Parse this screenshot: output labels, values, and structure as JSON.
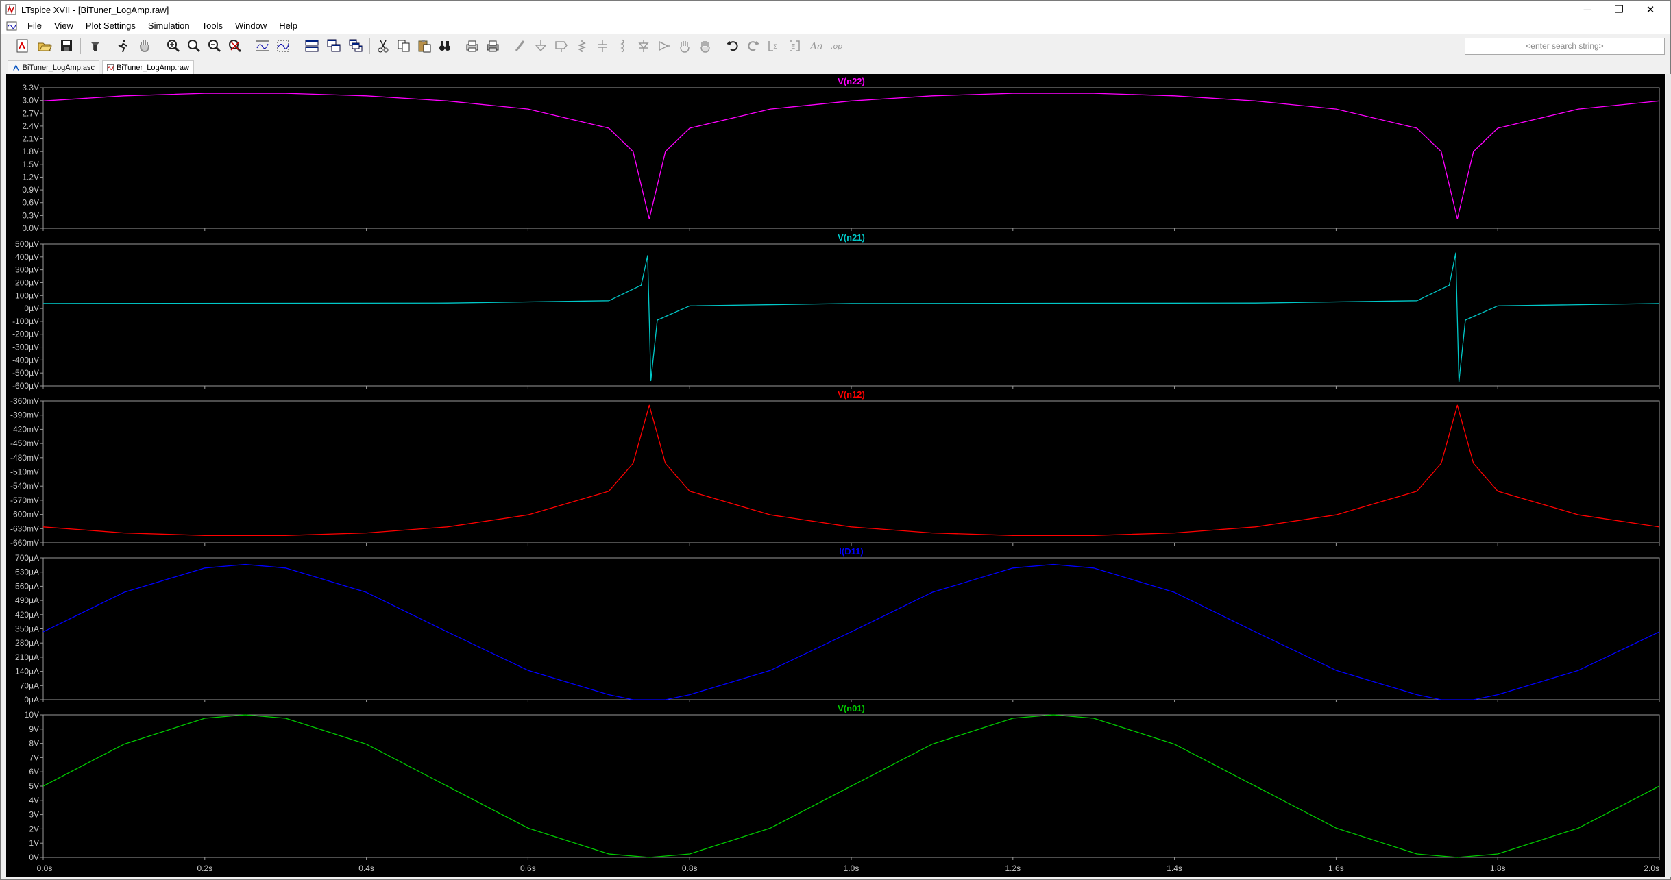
{
  "window": {
    "title": "LTspice XVII - [BiTuner_LogAmp.raw]",
    "minimize": "─",
    "restore": "❐",
    "close": "✕"
  },
  "menu": {
    "items": [
      {
        "label": "File",
        "icon": "file-menu"
      },
      {
        "label": "View",
        "icon": "view-menu"
      },
      {
        "label": "Plot Settings",
        "icon": "plot-settings-menu"
      },
      {
        "label": "Simulation",
        "icon": "simulation-menu"
      },
      {
        "label": "Tools",
        "icon": "tools-menu"
      },
      {
        "label": "Window",
        "icon": "window-menu"
      },
      {
        "label": "Help",
        "icon": "help-menu"
      }
    ],
    "mdi_minimize": "_",
    "mdi_restore": "▫",
    "mdi_close": "×"
  },
  "toolbar": {
    "search_placeholder": "<enter search string>",
    "buttons": [
      "new-schematic-icon",
      "open-icon",
      "save-icon",
      "control-panel-icon",
      "run-icon",
      "halt-icon",
      "zoom-in-icon",
      "zoom-out-icon",
      "zoom-fit-icon",
      "zoom-cancel-icon",
      "autorange-icon",
      "grid-icon",
      "tile-vertical-icon",
      "tile-horizontal-icon",
      "cascade-icon",
      "cut-icon",
      "copy-icon",
      "paste-icon",
      "find-icon",
      "print-icon",
      "print-setup-icon",
      "wire-icon",
      "ground-icon",
      "label-icon",
      "resistor-icon",
      "capacitor-icon",
      "inductor-icon",
      "diode-icon",
      "component-icon",
      "move-icon",
      "drag-icon",
      "undo-icon",
      "redo-icon",
      "rotate-icon",
      "mirror-icon",
      "text-icon",
      "spice-directive-icon"
    ]
  },
  "tabs": [
    {
      "label": "BiTuner_LogAmp.asc",
      "icon": "schematic-icon"
    },
    {
      "label": "BiTuner_LogAmp.raw",
      "icon": "waveform-icon"
    }
  ],
  "colors": {
    "vn22": "#ff00ff",
    "vn21": "#00c8c8",
    "vn12": "#ff0000",
    "id11": "#0000ff",
    "vn01": "#00c800",
    "plot_bg": "#000000",
    "grid_line": "#9a9a9a",
    "tick_text": "#c8c8c8"
  },
  "chart_data": [
    {
      "type": "line",
      "title": "V(n22)",
      "color": "#ff00ff",
      "ylabel": "",
      "yticks": [
        "3.3V",
        "3.0V",
        "2.7V",
        "2.4V",
        "2.1V",
        "1.8V",
        "1.5V",
        "1.2V",
        "0.9V",
        "0.6V",
        "0.3V",
        "0.0V"
      ],
      "ylim": [
        0,
        3.3
      ],
      "x": [
        0,
        0.1,
        0.2,
        0.3,
        0.4,
        0.5,
        0.6,
        0.7,
        0.73,
        0.75,
        0.77,
        0.8,
        0.9,
        1.0,
        1.1,
        1.2,
        1.3,
        1.4,
        1.5,
        1.6,
        1.7,
        1.73,
        1.75,
        1.77,
        1.8,
        1.9,
        2.0
      ],
      "y": [
        2.99,
        3.11,
        3.17,
        3.17,
        3.11,
        2.99,
        2.8,
        2.35,
        1.8,
        0.22,
        1.8,
        2.35,
        2.8,
        2.99,
        3.11,
        3.17,
        3.17,
        3.11,
        2.99,
        2.8,
        2.35,
        1.8,
        0.22,
        1.8,
        2.35,
        2.8,
        2.99
      ]
    },
    {
      "type": "line",
      "title": "V(n21)",
      "color": "#00c8c8",
      "yticks": [
        "500µV",
        "400µV",
        "300µV",
        "200µV",
        "100µV",
        "0µV",
        "-100µV",
        "-200µV",
        "-300µV",
        "-400µV",
        "-500µV",
        "-600µV"
      ],
      "ylim": [
        -600,
        500
      ],
      "x": [
        0,
        0.5,
        0.7,
        0.74,
        0.748,
        0.752,
        0.76,
        0.8,
        1.0,
        1.5,
        1.7,
        1.74,
        1.748,
        1.752,
        1.76,
        1.8,
        2.0
      ],
      "y": [
        38,
        42,
        60,
        180,
        410,
        -560,
        -90,
        20,
        38,
        42,
        60,
        180,
        430,
        -570,
        -90,
        20,
        38
      ]
    },
    {
      "type": "line",
      "title": "V(n12)",
      "color": "#ff0000",
      "yticks": [
        "-360mV",
        "-390mV",
        "-420mV",
        "-450mV",
        "-480mV",
        "-510mV",
        "-540mV",
        "-570mV",
        "-600mV",
        "-630mV",
        "-660mV"
      ],
      "ylim": [
        -665,
        -335
      ],
      "x": [
        0,
        0.1,
        0.2,
        0.3,
        0.4,
        0.5,
        0.6,
        0.7,
        0.73,
        0.75,
        0.77,
        0.8,
        0.9,
        1.0,
        1.1,
        1.2,
        1.3,
        1.4,
        1.5,
        1.6,
        1.7,
        1.73,
        1.75,
        1.77,
        1.8,
        1.9,
        2.0
      ],
      "y": [
        -628,
        -642,
        -648,
        -648,
        -642,
        -628,
        -600,
        -545,
        -480,
        -345,
        -480,
        -545,
        -600,
        -628,
        -642,
        -648,
        -648,
        -642,
        -628,
        -600,
        -545,
        -480,
        -345,
        -480,
        -545,
        -600,
        -628
      ]
    },
    {
      "type": "line",
      "title": "I(D11)",
      "color": "#0000ff",
      "yticks": [
        "700µA",
        "630µA",
        "560µA",
        "490µA",
        "420µA",
        "350µA",
        "280µA",
        "210µA",
        "140µA",
        "70µA",
        "0µA"
      ],
      "ylim": [
        0,
        700
      ],
      "x": [
        0,
        0.1,
        0.2,
        0.25,
        0.3,
        0.4,
        0.5,
        0.6,
        0.7,
        0.73,
        0.77,
        0.8,
        0.9,
        1.0,
        1.1,
        1.2,
        1.25,
        1.3,
        1.4,
        1.5,
        1.6,
        1.7,
        1.73,
        1.77,
        1.8,
        1.9,
        2.0
      ],
      "y": [
        335,
        530,
        650,
        668,
        650,
        530,
        335,
        145,
        25,
        0,
        0,
        25,
        145,
        335,
        530,
        650,
        668,
        650,
        530,
        335,
        145,
        25,
        0,
        0,
        25,
        145,
        335
      ]
    },
    {
      "type": "line",
      "title": "V(n01)",
      "color": "#00c800",
      "yticks": [
        "10V",
        "9V",
        "8V",
        "7V",
        "6V",
        "5V",
        "4V",
        "3V",
        "2V",
        "1V",
        "0V"
      ],
      "ylim": [
        0,
        10
      ],
      "x": [
        0,
        0.1,
        0.2,
        0.25,
        0.3,
        0.4,
        0.5,
        0.6,
        0.7,
        0.75,
        0.8,
        0.9,
        1.0,
        1.1,
        1.2,
        1.25,
        1.3,
        1.4,
        1.5,
        1.6,
        1.7,
        1.75,
        1.8,
        1.9,
        2.0
      ],
      "y": [
        5,
        7.94,
        9.76,
        10,
        9.76,
        7.94,
        5,
        2.06,
        0.24,
        0,
        0.24,
        2.06,
        5,
        7.94,
        9.76,
        10,
        9.76,
        7.94,
        5,
        2.06,
        0.24,
        0,
        0.24,
        2.06,
        5
      ]
    }
  ],
  "x_axis": {
    "xlim": [
      0,
      2.0
    ],
    "ticks": [
      "0.0s",
      "0.2s",
      "0.4s",
      "0.6s",
      "0.8s",
      "1.0s",
      "1.2s",
      "1.4s",
      "1.6s",
      "1.8s",
      "2.0s"
    ]
  }
}
